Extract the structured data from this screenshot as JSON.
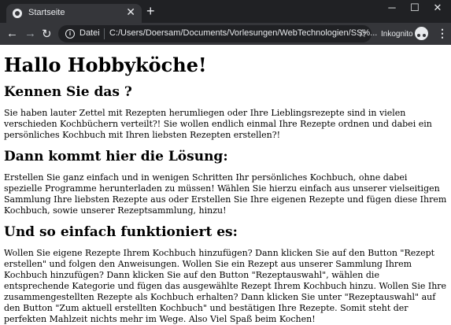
{
  "browser": {
    "tab_title": "Startseite",
    "tab_close": "✕",
    "new_tab": "+",
    "window_controls": {
      "minimize": "─",
      "maximize": "☐",
      "close": "✕"
    },
    "nav": {
      "back": "←",
      "forward": "→",
      "reload": "↻"
    },
    "omnibox": {
      "scheme_label": "Datei",
      "url": "C:/Users/Doersam/Documents/Vorlesungen/WebTechnologien/SS%...",
      "bookmark_icon": "star-icon"
    },
    "profile_label": "Inkognito",
    "menu": "⋮"
  },
  "page": {
    "title": "Hallo Hobbyköche!",
    "sections": [
      {
        "heading": "Kennen Sie das ?",
        "text": "Sie haben lauter Zettel mit Rezepten herumliegen oder Ihre Lieblingsrezepte sind in vielen verschieden Kochbüchern verteilt?! Sie wollen endlich einmal Ihre Rezepte ordnen und dabei ein persönliches Kochbuch mit Ihren liebsten Rezepten erstellen?!"
      },
      {
        "heading": "Dann kommt hier die Lösung:",
        "text": "Erstellen Sie ganz einfach und in wenigen Schritten Ihr persönliches Kochbuch, ohne dabei spezielle Programme herunterladen zu müssen! Wählen Sie hierzu einfach aus unserer vielseitigen Sammlung Ihre liebsten Rezepte aus oder Erstellen Sie Ihre eigenen Rezepte und fügen diese Ihrem Kochbuch, sowie unserer Rezeptsammlung, hinzu!"
      },
      {
        "heading": "Und so einfach funktioniert es:",
        "text": "Wollen Sie eigene Rezepte Ihrem Kochbuch hinzufügen? Dann klicken Sie auf den Button \"Rezept erstellen\" und folgen den Anweisungen. Wollen Sie ein Rezept aus unserer Sammlung Ihrem Kochbuch hinzufügen? Dann klicken Sie auf den Button \"Rezeptauswahl\", wählen die entsprechende Kategorie und fügen das ausgewählte Rezept Ihrem Kochbuch hinzu. Wollen Sie Ihre zusammengestellten Rezepte als Kochbuch erhalten? Dann klicken Sie unter \"Rezeptauswahl\" auf den Button \"Zum aktuell erstellten Kochbuch\" und bestätigen Ihre Rezepte. Somit steht der perfekten Mahlzeit nichts mehr im Wege. Also Viel Spaß beim Kochen!"
      }
    ]
  }
}
